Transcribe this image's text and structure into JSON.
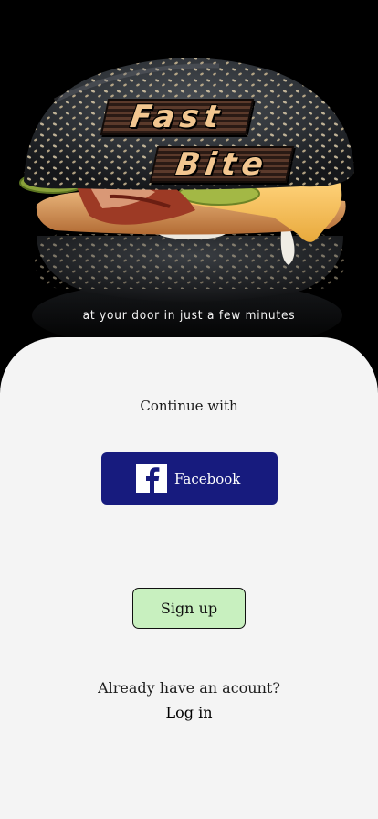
{
  "hero": {
    "logo_line1": "Fast",
    "logo_line2": "Bite",
    "tagline": "at your door in just a few minutes"
  },
  "auth": {
    "continue_label": "Continue with",
    "facebook_label": "Facebook",
    "signup_label": "Sign up",
    "already_label": "Already have an acount?",
    "login_label": "Log in"
  },
  "colors": {
    "sheet_background": "#f4f4f4",
    "facebook_button": "#171b7e",
    "signup_button": "#c8f0bf",
    "logo_text": "#f2c690"
  },
  "icons": {
    "facebook": "facebook-icon"
  }
}
